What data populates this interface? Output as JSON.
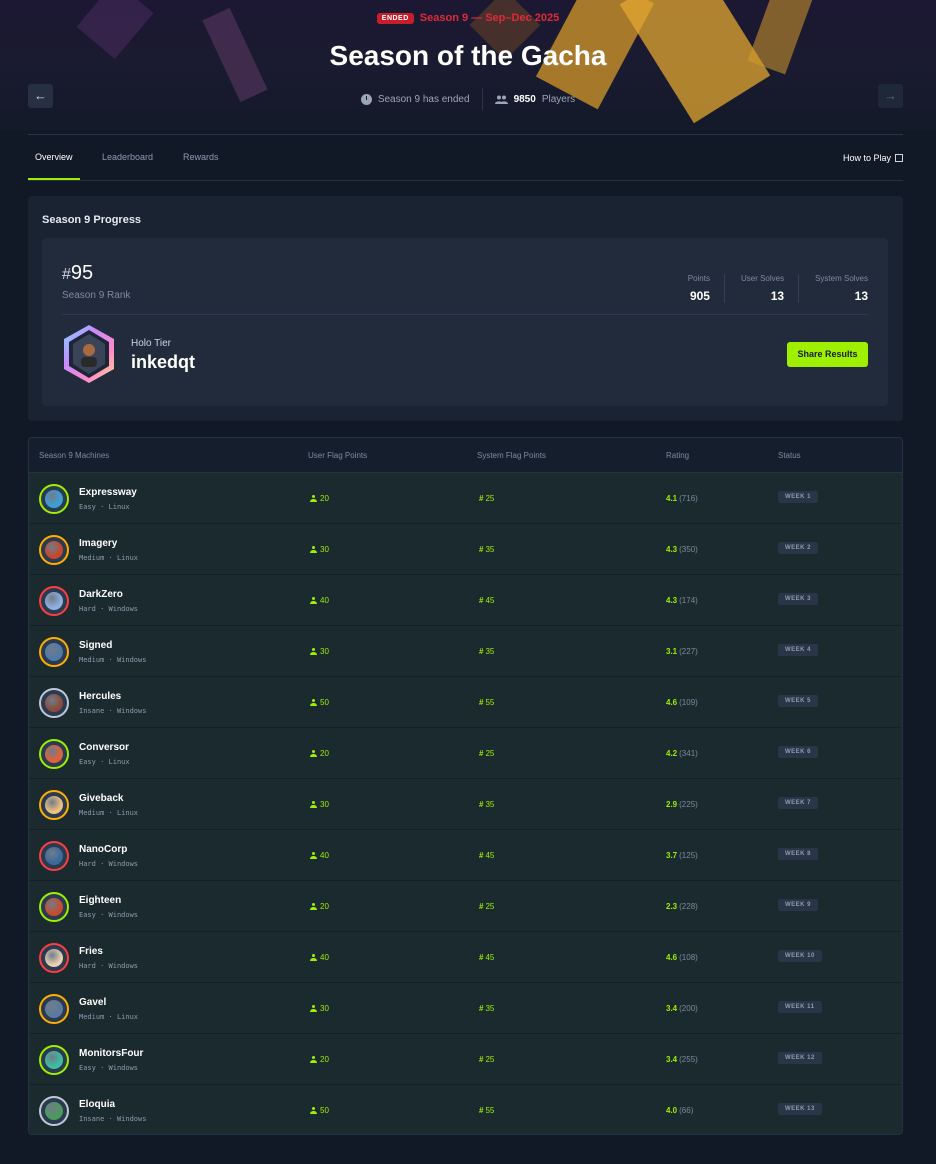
{
  "header": {
    "ended_badge": "ENDED",
    "season_dates": "Season 9 — Sep–Dec 2025",
    "title": "Season of the Gacha",
    "status_text": "Season 9 has ended",
    "players_count": "9850",
    "players_label": "Players",
    "prev_icon": "arrow-left-icon",
    "next_icon": "arrow-right-icon"
  },
  "tabs": {
    "overview": "Overview",
    "leaderboard": "Leaderboard",
    "rewards": "Rewards",
    "how_to_play": "How to Play"
  },
  "progress": {
    "title": "Season 9 Progress",
    "rank_symbol": "#",
    "rank": "95",
    "rank_label": "Season 9 Rank",
    "points_label": "Points",
    "points": "905",
    "user_solves_label": "User Solves",
    "user_solves": "13",
    "system_solves_label": "System Solves",
    "system_solves": "13",
    "tier": "Holo Tier",
    "username": "inkedqt",
    "share_label": "Share Results"
  },
  "table": {
    "headers": {
      "machines": "Season 9 Machines",
      "user_flag": "User Flag Points",
      "system_flag": "System Flag Points",
      "rating": "Rating",
      "status": "Status"
    },
    "rows": [
      {
        "name": "Expressway",
        "difficulty": "Easy",
        "os": "Linux",
        "user_points": "20",
        "system_points": "25",
        "rating": "4.1",
        "rating_count": "(716)",
        "status": "WEEK 1",
        "ring": "#9fef00",
        "inner": "#3aa0d8"
      },
      {
        "name": "Imagery",
        "difficulty": "Medium",
        "os": "Linux",
        "user_points": "30",
        "system_points": "35",
        "rating": "4.3",
        "rating_count": "(350)",
        "status": "WEEK 2",
        "ring": "#ffaf00",
        "inner": "#c8462a"
      },
      {
        "name": "DarkZero",
        "difficulty": "Hard",
        "os": "Windows",
        "user_points": "40",
        "system_points": "45",
        "rating": "4.3",
        "rating_count": "(174)",
        "status": "WEEK 3",
        "ring": "#ff3e3e",
        "inner": "#8fb0e0"
      },
      {
        "name": "Signed",
        "difficulty": "Medium",
        "os": "Windows",
        "user_points": "30",
        "system_points": "35",
        "rating": "3.1",
        "rating_count": "(227)",
        "status": "WEEK 4",
        "ring": "#ffaf00",
        "inner": "#4e7aa8"
      },
      {
        "name": "Hercules",
        "difficulty": "Insane",
        "os": "Windows",
        "user_points": "50",
        "system_points": "55",
        "rating": "4.6",
        "rating_count": "(109)",
        "status": "WEEK 5",
        "ring": "#c0c8d4",
        "inner": "#8a4a3a"
      },
      {
        "name": "Conversor",
        "difficulty": "Easy",
        "os": "Linux",
        "user_points": "20",
        "system_points": "25",
        "rating": "4.2",
        "rating_count": "(341)",
        "status": "WEEK 6",
        "ring": "#9fef00",
        "inner": "#e0603a"
      },
      {
        "name": "Giveback",
        "difficulty": "Medium",
        "os": "Linux",
        "user_points": "30",
        "system_points": "35",
        "rating": "2.9",
        "rating_count": "(225)",
        "status": "WEEK 7",
        "ring": "#ffaf00",
        "inner": "#f0c080"
      },
      {
        "name": "NanoCorp",
        "difficulty": "Hard",
        "os": "Windows",
        "user_points": "40",
        "system_points": "45",
        "rating": "3.7",
        "rating_count": "(125)",
        "status": "WEEK 8",
        "ring": "#ff3e3e",
        "inner": "#3a6a9a"
      },
      {
        "name": "Eighteen",
        "difficulty": "Easy",
        "os": "Windows",
        "user_points": "20",
        "system_points": "25",
        "rating": "2.3",
        "rating_count": "(228)",
        "status": "WEEK 9",
        "ring": "#9fef00",
        "inner": "#c84a2a"
      },
      {
        "name": "Fries",
        "difficulty": "Hard",
        "os": "Windows",
        "user_points": "40",
        "system_points": "45",
        "rating": "4.6",
        "rating_count": "(108)",
        "status": "WEEK 10",
        "ring": "#ff3e3e",
        "inner": "#e8d0b0"
      },
      {
        "name": "Gavel",
        "difficulty": "Medium",
        "os": "Linux",
        "user_points": "30",
        "system_points": "35",
        "rating": "3.4",
        "rating_count": "(200)",
        "status": "WEEK 11",
        "ring": "#ffaf00",
        "inner": "#5a7aa0"
      },
      {
        "name": "MonitorsFour",
        "difficulty": "Easy",
        "os": "Windows",
        "user_points": "20",
        "system_points": "25",
        "rating": "3.4",
        "rating_count": "(255)",
        "status": "WEEK 12",
        "ring": "#9fef00",
        "inner": "#3ac0a0"
      },
      {
        "name": "Eloquia",
        "difficulty": "Insane",
        "os": "Windows",
        "user_points": "50",
        "system_points": "55",
        "rating": "4.0",
        "rating_count": "(66)",
        "status": "WEEK 13",
        "ring": "#c0c8d4",
        "inner": "#4a9a5a"
      }
    ]
  },
  "colors": {
    "accent": "#9fef00",
    "ended": "#e02a36",
    "background": "#111927"
  }
}
